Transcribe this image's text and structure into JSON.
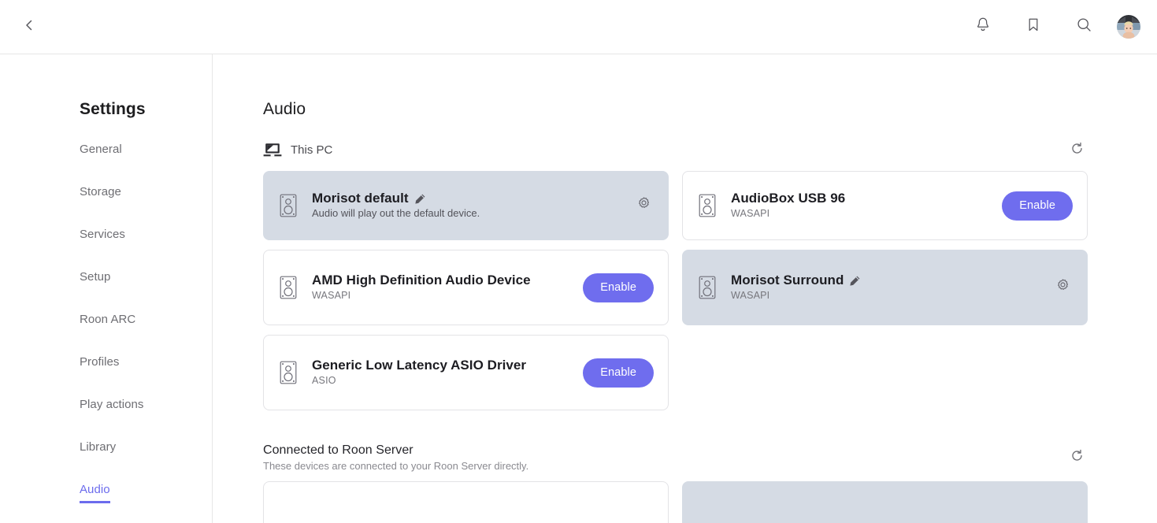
{
  "topbar": {
    "back_icon": "chevron-left-icon",
    "icons": [
      {
        "name": "notifications-icon",
        "glyph": "bell"
      },
      {
        "name": "bookmark-icon",
        "glyph": "bookmark"
      },
      {
        "name": "search-icon",
        "glyph": "magnifier"
      }
    ],
    "avatar_label": "user-avatar"
  },
  "sidebar": {
    "title": "Settings",
    "items": [
      {
        "label": "General",
        "active": false
      },
      {
        "label": "Storage",
        "active": false
      },
      {
        "label": "Services",
        "active": false
      },
      {
        "label": "Setup",
        "active": false
      },
      {
        "label": "Roon ARC",
        "active": false
      },
      {
        "label": "Profiles",
        "active": false
      },
      {
        "label": "Play actions",
        "active": false
      },
      {
        "label": "Library",
        "active": false
      },
      {
        "label": "Audio",
        "active": true
      }
    ],
    "active_color": "#6c6ced"
  },
  "main": {
    "page_title": "Audio",
    "sections": [
      {
        "label": "This PC",
        "icon": "laptop-icon",
        "refresh_icon": "refresh-icon",
        "devices": [
          {
            "name": "Morisot default",
            "subtitle": "Audio will play out the default device.",
            "subtitle_style": "long",
            "selected": true,
            "editable": true,
            "action": "gear",
            "icon": "speaker-icon"
          },
          {
            "name": "AudioBox USB 96",
            "subtitle": "WASAPI",
            "subtitle_style": "short",
            "selected": false,
            "editable": false,
            "action": "enable",
            "action_label": "Enable",
            "icon": "speaker-icon"
          },
          {
            "name": "AMD High Definition Audio Device",
            "subtitle": "WASAPI",
            "subtitle_style": "short",
            "selected": false,
            "editable": false,
            "action": "enable",
            "action_label": "Enable",
            "icon": "speaker-icon"
          },
          {
            "name": "Morisot Surround",
            "subtitle": "WASAPI",
            "subtitle_style": "short",
            "selected": true,
            "editable": true,
            "action": "gear",
            "icon": "speaker-icon"
          },
          {
            "name": "Generic Low Latency ASIO Driver",
            "subtitle": "ASIO",
            "subtitle_style": "short",
            "selected": false,
            "editable": false,
            "action": "enable",
            "action_label": "Enable",
            "icon": "speaker-icon"
          }
        ]
      },
      {
        "title": "Connected to Roon Server",
        "subtitle": "These devices are connected to your Roon Server directly.",
        "refresh_icon": "refresh-icon"
      }
    ]
  },
  "colors": {
    "accent": "#6f6dee",
    "selected_card": "#d5dbe4",
    "card_border": "#e3e3e6",
    "text_primary": "#1d1d22",
    "text_muted": "#76767c"
  }
}
